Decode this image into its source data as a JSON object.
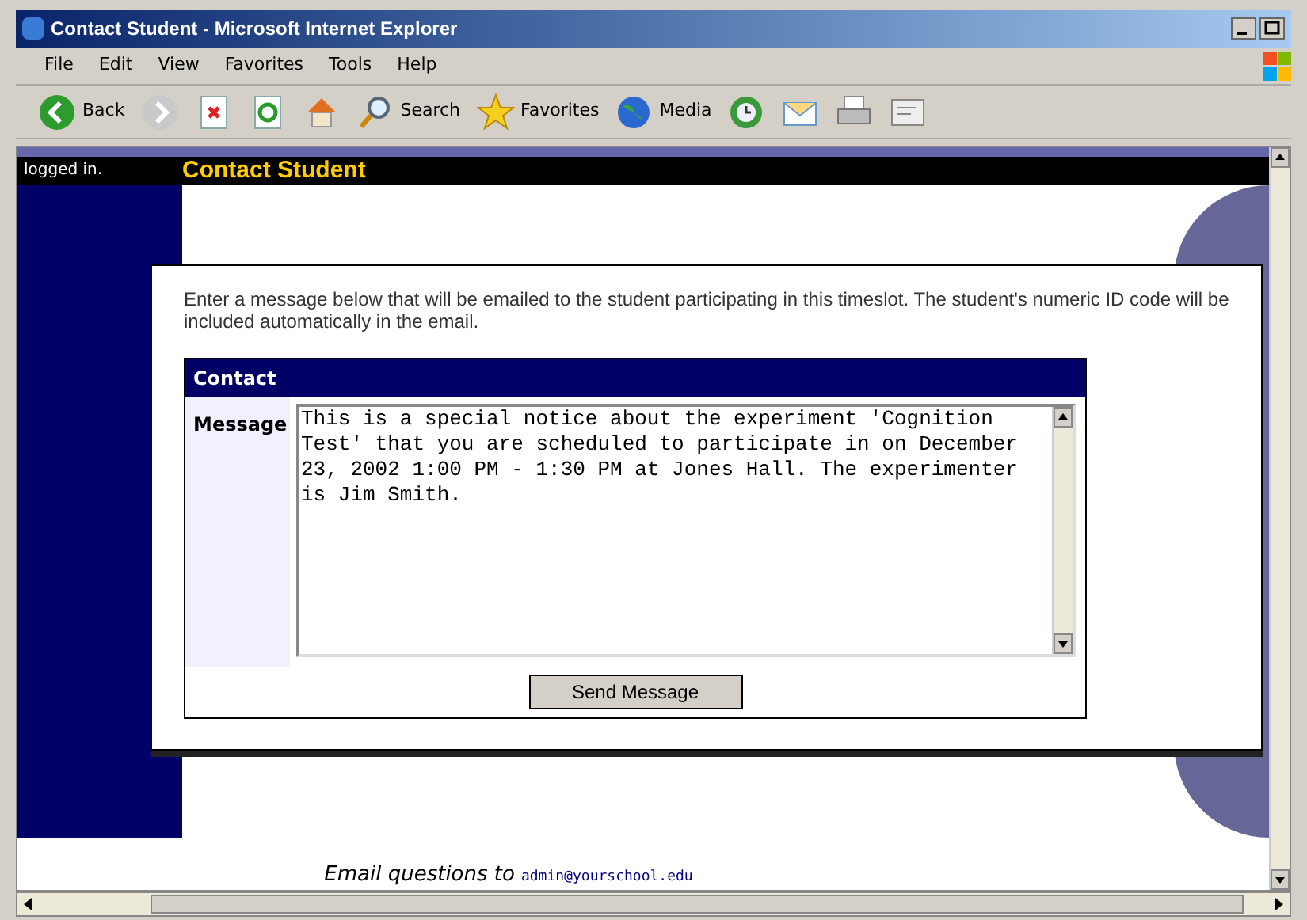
{
  "window": {
    "title": "Contact Student - Microsoft Internet Explorer"
  },
  "menu": [
    "File",
    "Edit",
    "View",
    "Favorites",
    "Tools",
    "Help"
  ],
  "toolbar": [
    {
      "kind": "back",
      "label": "Back"
    },
    {
      "kind": "forward"
    },
    {
      "kind": "stop"
    },
    {
      "kind": "refresh"
    },
    {
      "kind": "home"
    },
    {
      "kind": "search",
      "label": "Search"
    },
    {
      "kind": "favorites",
      "label": "Favorites"
    },
    {
      "kind": "media",
      "label": "Media"
    },
    {
      "kind": "history"
    },
    {
      "kind": "mail"
    },
    {
      "kind": "print"
    },
    {
      "kind": "edit"
    }
  ],
  "header": {
    "status": "logged in.",
    "title": "Contact Student"
  },
  "intro": "Enter a message below that will be emailed to the student participating in this timeslot. The student's numeric ID code will be included automatically in the email.",
  "form": {
    "heading": "Contact",
    "field_label": "Message",
    "message": "This is a special notice about the experiment 'Cognition Test' that you are scheduled to participate in on December 23, 2002 1:00 PM - 1:30 PM at Jones Hall. The experimenter is Jim Smith.",
    "button": "Send Message"
  },
  "footer": {
    "text": "Email questions to",
    "email": "admin@yourschool.edu"
  }
}
